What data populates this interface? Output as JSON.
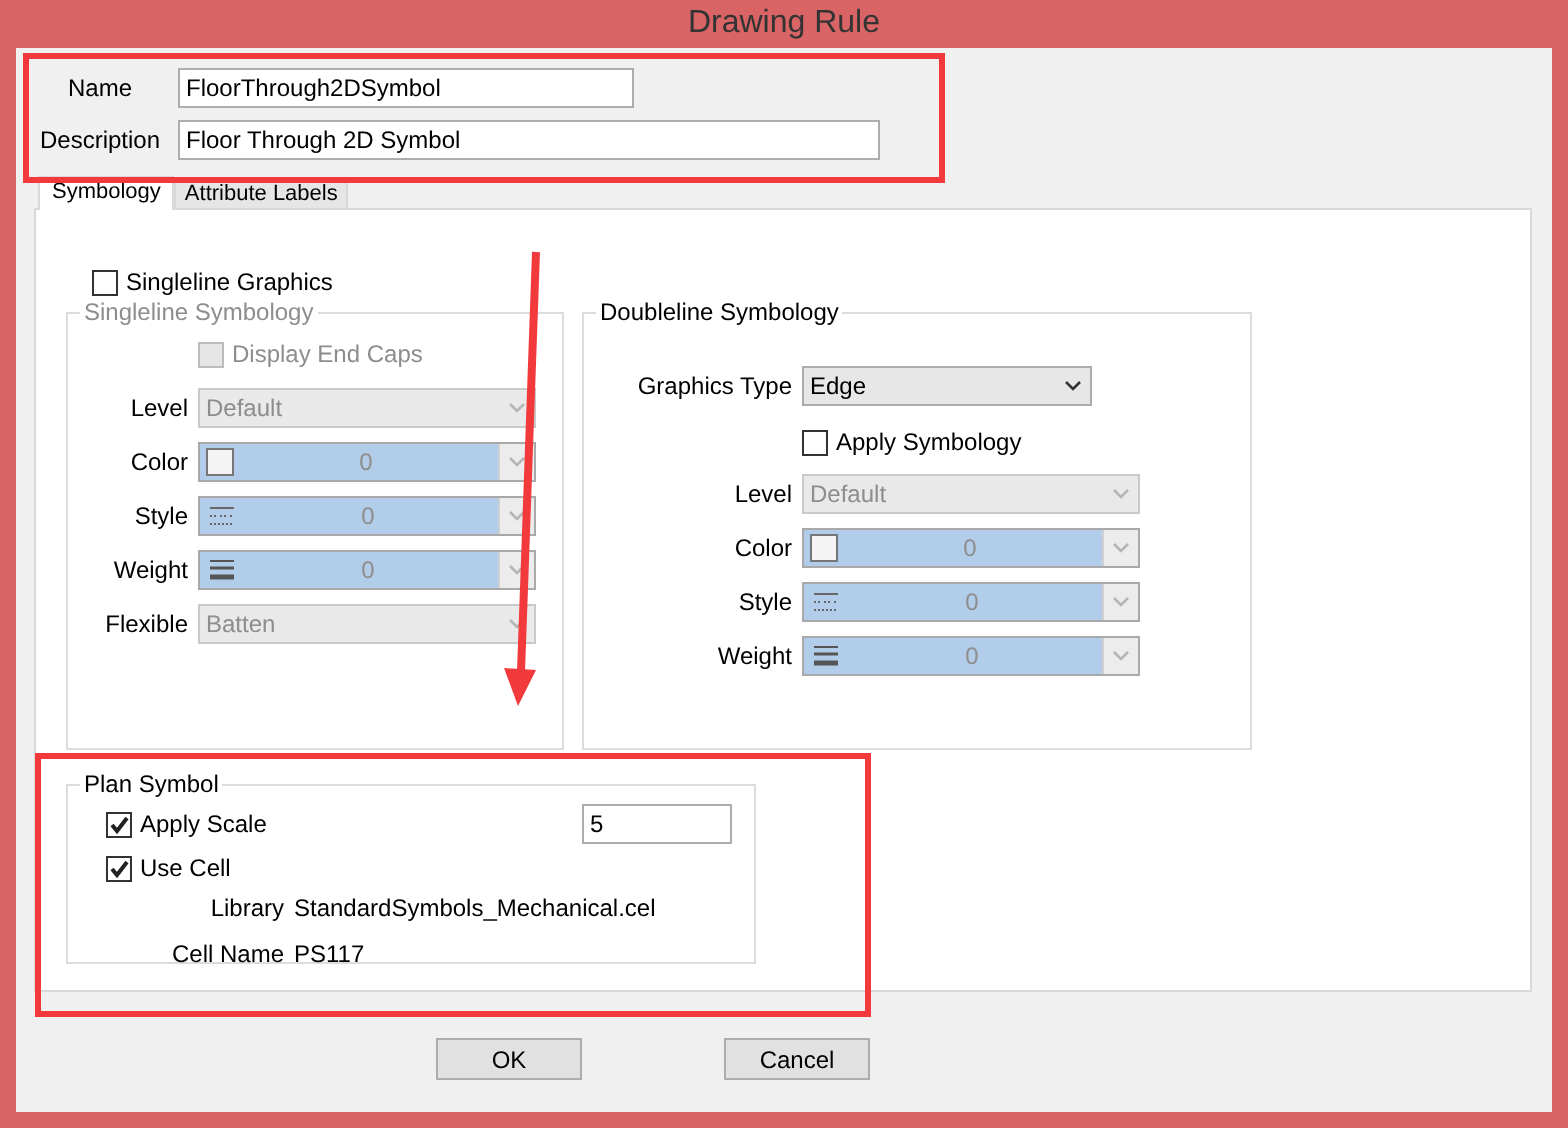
{
  "window": {
    "title": "Drawing Rule"
  },
  "fields": [
    {
      "label": "Name",
      "value": "FloorThrough2DSymbol",
      "kind": "short"
    },
    {
      "label": "Description",
      "value": "Floor Through 2D Symbol",
      "kind": "long"
    }
  ],
  "tabs": [
    {
      "label": "Symbology",
      "selected": true
    },
    {
      "label": "Attribute Labels",
      "selected": false
    }
  ],
  "singleline_graphics": {
    "label": "Singleline Graphics",
    "checked": false
  },
  "singleline_symbology": {
    "title": "Singleline Symbology",
    "disabled": true,
    "display_end_caps": {
      "label": "Display End Caps",
      "checked": false
    },
    "rows": [
      {
        "label": "Level",
        "kind": "plain",
        "value": "Default"
      },
      {
        "label": "Color",
        "kind": "color",
        "value": "0"
      },
      {
        "label": "Style",
        "kind": "style",
        "value": "0"
      },
      {
        "label": "Weight",
        "kind": "weight",
        "value": "0"
      },
      {
        "label": "Flexible",
        "kind": "plain",
        "value": "Batten"
      }
    ]
  },
  "doubleline_symbology": {
    "title": "Doubleline Symbology",
    "disabled": false,
    "graphics_type": {
      "label": "Graphics Type",
      "value": "Edge"
    },
    "apply_symbology": {
      "label": "Apply Symbology",
      "checked": false
    },
    "rows": [
      {
        "label": "Level",
        "kind": "plain",
        "value": "Default"
      },
      {
        "label": "Color",
        "kind": "color",
        "value": "0"
      },
      {
        "label": "Style",
        "kind": "style",
        "value": "0"
      },
      {
        "label": "Weight",
        "kind": "weight",
        "value": "0"
      }
    ]
  },
  "plan_symbol": {
    "title": "Plan Symbol",
    "apply_scale": {
      "label": "Apply Scale",
      "checked": true,
      "value": "5"
    },
    "use_cell": {
      "label": "Use Cell",
      "checked": true
    },
    "library": {
      "label": "Library",
      "value": "StandardSymbols_Mechanical.cel"
    },
    "cell_name": {
      "label": "Cell Name",
      "value": "PS117"
    }
  },
  "buttons": [
    {
      "label": "OK"
    },
    {
      "label": "Cancel"
    }
  ],
  "annotations": [
    {
      "kind": "box"
    },
    {
      "kind": "box"
    },
    {
      "kind": "arrow"
    }
  ]
}
